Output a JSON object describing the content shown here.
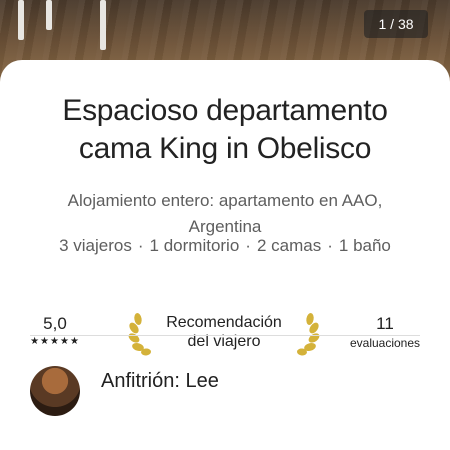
{
  "photo": {
    "counter": "1 / 38"
  },
  "listing": {
    "title_line1": "Espacioso departamento",
    "title_line2": "cama King in Obelisco",
    "subtitle": "Alojamiento entero: apartamento en AAO, Argentina",
    "details": {
      "guests": "3 viajeros",
      "bedrooms": "1 dormitorio",
      "beds": "2 camas",
      "baths": "1 baño",
      "separator": "·"
    }
  },
  "stats": {
    "rating_value": "5,0",
    "stars": "★★★★★",
    "award_line1": "Recomendación",
    "award_line2": "del viajero",
    "reviews_count": "11",
    "reviews_label": "evaluaciones",
    "laurel_color": "#d4b23a"
  },
  "host": {
    "label": "Anfitrión: Lee"
  }
}
